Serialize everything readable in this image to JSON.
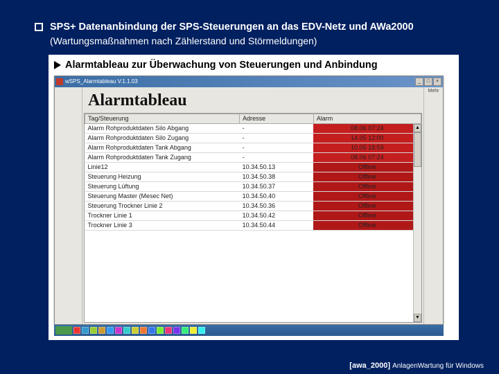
{
  "header": {
    "main": "SPS+ Datenanbindung der SPS-Steuerungen an das EDV-Netz und AWa2000",
    "sub": "(Wartungsmaßnahmen nach Zählerstand und Störmeldungen)"
  },
  "section": {
    "title": "Alarmtableau zur Überwachung von Steuerungen und Anbindung"
  },
  "window": {
    "title": "wSPS_Alarmtableau V.1.1.03",
    "min": "_",
    "max": "□",
    "close": "×",
    "right_label": "Mehr"
  },
  "app": {
    "title": "Alarmtableau",
    "columns": {
      "tag": "Tag/Steuerung",
      "addr": "Adresse",
      "alarm": "Alarm"
    },
    "rows": [
      {
        "tag": "Alarm Rohproduktdaten Silo Abgang",
        "addr": "-",
        "alarm": "08.06 07:24",
        "type": "red"
      },
      {
        "tag": "Alarm Rohproduktdaten Silo Zugang",
        "addr": "-",
        "alarm": "14.05 12:00",
        "type": "red"
      },
      {
        "tag": "Alarm Rohproduktdaten Tank Abgang",
        "addr": "-",
        "alarm": "10.05 18:59",
        "type": "red"
      },
      {
        "tag": "Alarm Rohproduktdaten Tank Zugang",
        "addr": "-",
        "alarm": "08.06 07:24",
        "type": "red"
      },
      {
        "tag": "Linie12",
        "addr": "10.34.50.13",
        "alarm": "Offline",
        "type": "off"
      },
      {
        "tag": "Steuerung Heizung",
        "addr": "10.34.50.38",
        "alarm": "Offline",
        "type": "off"
      },
      {
        "tag": "Steuerung Lüftung",
        "addr": "10.34.50.37",
        "alarm": "Offline",
        "type": "off"
      },
      {
        "tag": "Steuerung Master (Mesec Net)",
        "addr": "10.34.50.40",
        "alarm": "Offline",
        "type": "off"
      },
      {
        "tag": "Steuerung Trockner Linie 2",
        "addr": "10.34.50.36",
        "alarm": "Offline",
        "type": "off"
      },
      {
        "tag": "Trockner Linie 1",
        "addr": "10.34.50.42",
        "alarm": "Offline",
        "type": "off"
      },
      {
        "tag": "Trockner Linie 3",
        "addr": "10.34.50.44",
        "alarm": "Offline",
        "type": "off"
      }
    ],
    "scroll_up": "▲",
    "scroll_down": "▼"
  },
  "taskbar": {
    "icon_colors": [
      "#e33",
      "#39c",
      "#9c3",
      "#c93",
      "#39e",
      "#c3c",
      "#3cc",
      "#cc3",
      "#e73",
      "#37e",
      "#7e3",
      "#e37",
      "#73e",
      "#3e7",
      "#ee3",
      "#3ee"
    ]
  },
  "footer": {
    "brand": "[awa_2000]",
    "tag": "AnlagenWartung für Windows"
  }
}
